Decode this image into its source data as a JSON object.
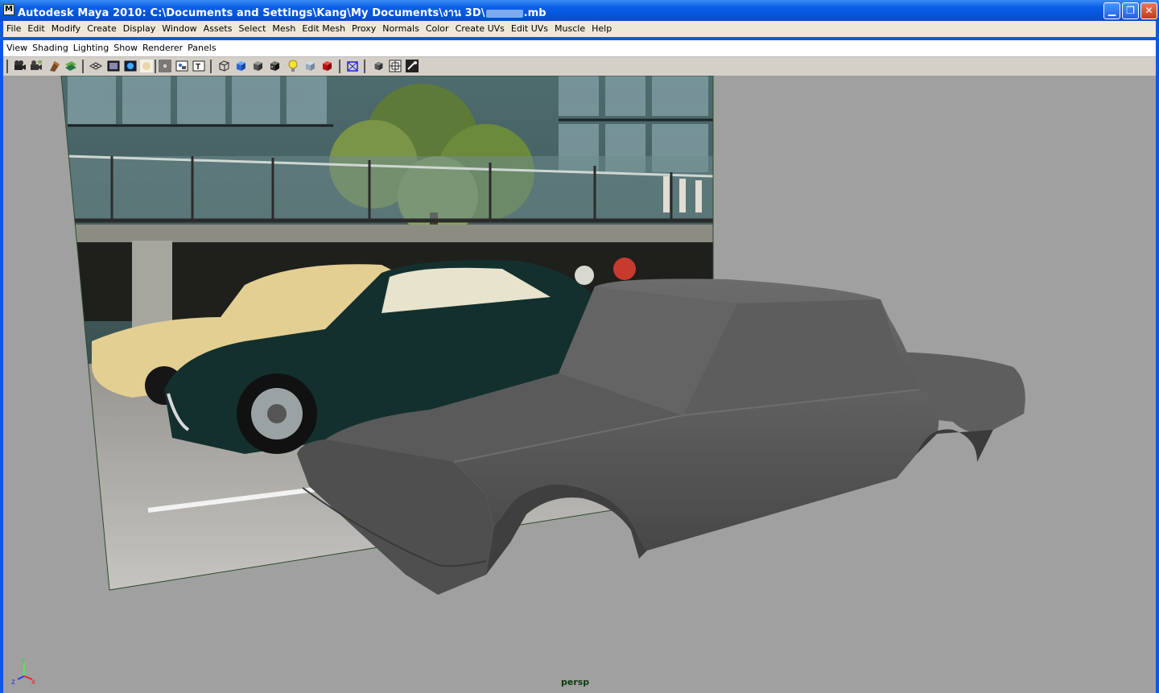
{
  "window": {
    "title": "Autodesk Maya 2010: C:\\Documents and Settings\\Kang\\My Documents\\งาน 3D\\",
    "title_suffix": ".mb",
    "minimize_icon": "minimize-icon",
    "maximize_icon": "restore-icon",
    "close_icon": "close-icon"
  },
  "main_menu": [
    "File",
    "Edit",
    "Modify",
    "Create",
    "Display",
    "Window",
    "Assets",
    "Select",
    "Mesh",
    "Edit Mesh",
    "Proxy",
    "Normals",
    "Color",
    "Create UVs",
    "Edit UVs",
    "Muscle",
    "Help"
  ],
  "panel_menu": [
    "View",
    "Shading",
    "Lighting",
    "Show",
    "Renderer",
    "Panels"
  ],
  "toolbar_icons": [
    "select-camera-icon",
    "camera-attributes-icon",
    "bookmark-icon",
    "image-plane-icon",
    "grid-icon",
    "film-gate-icon",
    "resolution-gate-icon",
    "gate-mask-icon",
    "field-chart-icon",
    "safe-action-icon",
    "safe-title-icon",
    "wireframe-icon",
    "smooth-shade-icon",
    "default-material-icon",
    "textured-icon",
    "lights-icon",
    "shadows-icon",
    "xray-icon",
    "isolate-select-icon",
    "highlight-select-icon",
    "xray-joints-icon",
    "wireframe-on-shaded-icon",
    "depth-peeling-icon"
  ],
  "viewport": {
    "camera": "persp",
    "axis": {
      "x": "x",
      "y": "y",
      "z": "z"
    },
    "background": "#a0a0a0",
    "model_color": "#5b5b5b",
    "image_plane": "reference photo of classic cars"
  },
  "colors": {
    "titlebar": "#0b5fe8",
    "menubar": "#ece9d8",
    "panel": "#d4d0c8",
    "close_button": "#c43a16"
  }
}
